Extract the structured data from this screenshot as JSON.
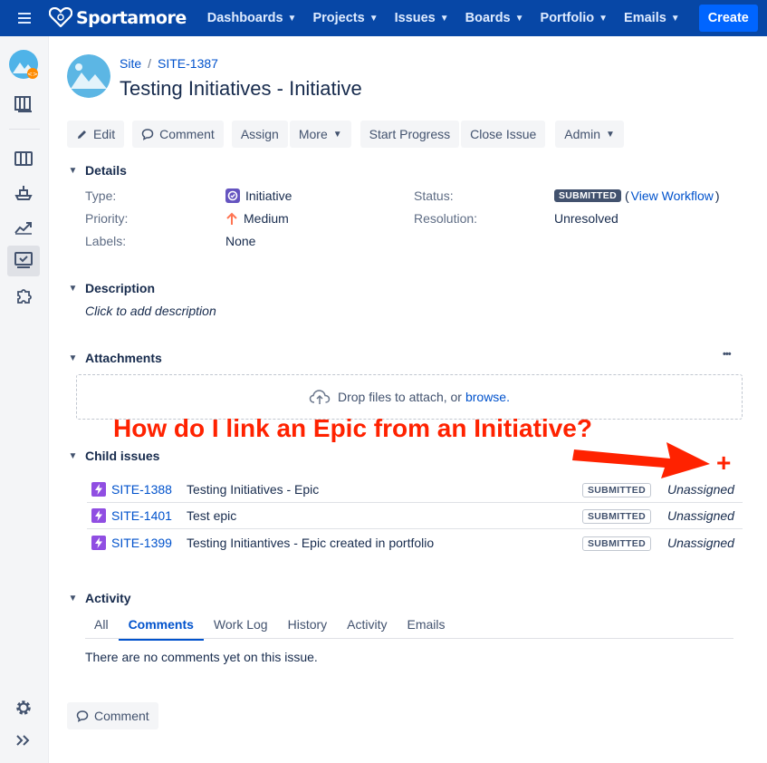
{
  "nav": {
    "brand": "Sportamore",
    "items": [
      "Dashboards",
      "Projects",
      "Issues",
      "Boards",
      "Portfolio",
      "Emails"
    ],
    "create_label": "Create"
  },
  "sidebar": {
    "icons": [
      "project-avatar-icon",
      "backlog-icon",
      "board-icon",
      "releases-icon",
      "reports-icon",
      "issues-icon",
      "addons-icon",
      "settings-icon",
      "expand-icon"
    ]
  },
  "breadcrumb": {
    "project": "Site",
    "sep": "/",
    "key": "SITE-1387"
  },
  "issue": {
    "title": "Testing Initiatives - Initiative"
  },
  "toolbar": {
    "edit": "Edit",
    "comment": "Comment",
    "assign": "Assign",
    "more": "More",
    "start_progress": "Start Progress",
    "close_issue": "Close Issue",
    "admin": "Admin"
  },
  "details": {
    "heading": "Details",
    "type_label": "Type:",
    "type_value": "Initiative",
    "priority_label": "Priority:",
    "priority_value": "Medium",
    "labels_label": "Labels:",
    "labels_value": "None",
    "status_label": "Status:",
    "status_value": "SUBMITTED",
    "workflow_link": "View Workflow",
    "workflow_open": "(",
    "workflow_close": ")",
    "resolution_label": "Resolution:",
    "resolution_value": "Unresolved"
  },
  "description": {
    "heading": "Description",
    "placeholder": "Click to add description"
  },
  "attachments": {
    "heading": "Attachments",
    "more": "•••",
    "drop_text": "Drop files to attach, or",
    "browse": "browse."
  },
  "child_issues": {
    "heading": "Child issues",
    "add_symbol": "+",
    "rows": [
      {
        "key": "SITE-1388",
        "summary": "Testing Initiatives - Epic",
        "status": "SUBMITTED",
        "assignee": "Unassigned"
      },
      {
        "key": "SITE-1401",
        "summary": "Test epic",
        "status": "SUBMITTED",
        "assignee": "Unassigned"
      },
      {
        "key": "SITE-1399",
        "summary": "Testing Initiantives - Epic created in portfolio",
        "status": "SUBMITTED",
        "assignee": "Unassigned"
      }
    ]
  },
  "activity": {
    "heading": "Activity",
    "tabs": [
      "All",
      "Comments",
      "Work Log",
      "History",
      "Activity",
      "Emails"
    ],
    "active_tab": "Comments",
    "empty_text": "There are no comments yet on this issue.",
    "comment_button": "Comment"
  },
  "annotation": {
    "text": "How do I link an Epic from an Initiative?",
    "color": "#ff2200"
  },
  "colors": {
    "nav_bg": "#0747a6",
    "link": "#0052cc",
    "create": "#0065ff",
    "epic": "#904ee2",
    "initiative": "#6554c0"
  }
}
